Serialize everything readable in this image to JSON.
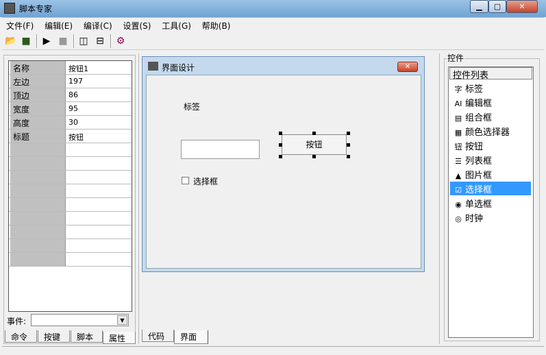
{
  "app": {
    "title": "脚本专家"
  },
  "menu": [
    "文件(F)",
    "编辑(E)",
    "编译(C)",
    "设置(S)",
    "工具(G)",
    "帮助(B)"
  ],
  "properties": [
    {
      "key": "名称",
      "value": "按钮1"
    },
    {
      "key": "左边",
      "value": "197"
    },
    {
      "key": "顶边",
      "value": "86"
    },
    {
      "key": "宽度",
      "value": "95"
    },
    {
      "key": "高度",
      "value": "30"
    },
    {
      "key": "标题",
      "value": "按钮"
    }
  ],
  "event": {
    "label": "事件:",
    "value": ""
  },
  "left_tabs": [
    "命令",
    "按键",
    "脚本",
    "属性"
  ],
  "center_tabs": [
    "代码",
    "界面"
  ],
  "design": {
    "title": "界面设计",
    "label_text": "标签",
    "button_text": "按钮",
    "checkbox_text": "选择框",
    "edit_value": ""
  },
  "controls": {
    "group_label": "控件",
    "header": "控件列表",
    "selected": "选择框",
    "items": [
      {
        "icon": "字",
        "label": "标签"
      },
      {
        "icon": "AI",
        "label": "编辑框"
      },
      {
        "icon": "▤",
        "label": "组合框"
      },
      {
        "icon": "▦",
        "label": "颜色选择器"
      },
      {
        "icon": "钮",
        "label": "按钮"
      },
      {
        "icon": "☰",
        "label": "列表框"
      },
      {
        "icon": "▲",
        "label": "图片框"
      },
      {
        "icon": "☑",
        "label": "选择框"
      },
      {
        "icon": "◉",
        "label": "单选框"
      },
      {
        "icon": "◎",
        "label": "时钟"
      }
    ]
  }
}
